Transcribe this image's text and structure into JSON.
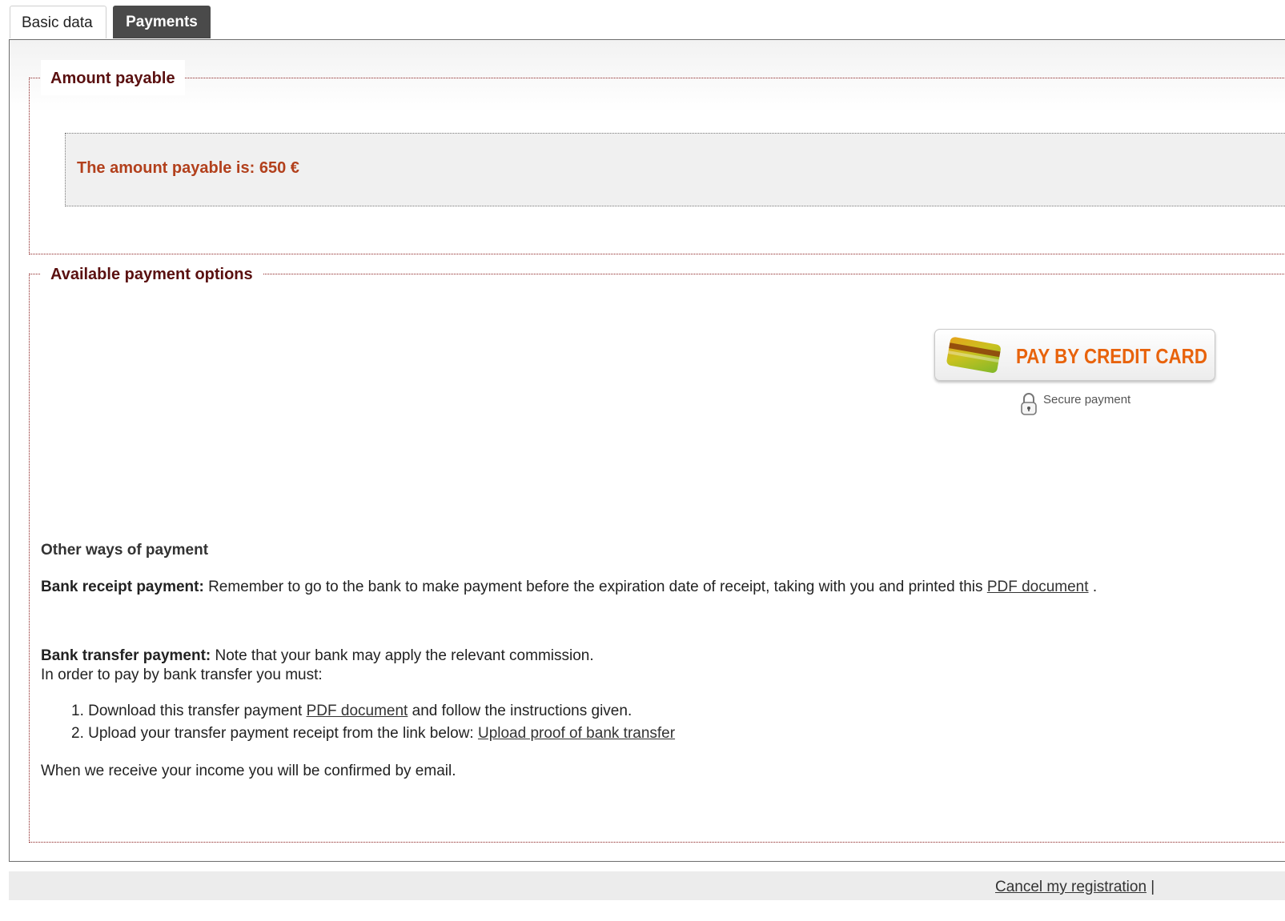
{
  "tabs": [
    {
      "label": "Basic data",
      "active": false
    },
    {
      "label": "Payments",
      "active": true
    }
  ],
  "amount_section": {
    "legend": "Amount payable",
    "text": "The amount payable is: 650 €"
  },
  "options_section": {
    "legend": "Available payment options",
    "credit_card_button": "PAY BY CREDIT CARD",
    "secure_label": "Secure payment",
    "other_title": "Other ways of payment",
    "bank_receipt": {
      "label": "Bank receipt payment:",
      "text": " Remember to go to the bank to make payment before the expiration date of receipt, taking with you and printed this ",
      "link": "PDF document",
      "tail": " ."
    },
    "bank_transfer": {
      "label": "Bank transfer payment:",
      "text": " Note that your bank may apply the relevant commission.",
      "line2": "In order to pay by bank transfer you must:",
      "step1_num": "1.",
      "step1_text": " Download this transfer payment ",
      "step1_link": "PDF document",
      "step1_tail": " and follow the instructions given.",
      "step2_num": "2.",
      "step2_text": " Upload your transfer payment receipt from the link below: ",
      "step2_link": "Upload proof of bank transfer"
    },
    "confirmation": "When we receive your income you will be confirmed by email."
  },
  "footer": {
    "cancel_link": "Cancel my registration",
    "separator": " |"
  },
  "colors": {
    "legend": "#5a1010",
    "amount_text": "#b2401c",
    "button_text": "#e8630c",
    "active_tab": "#4a4a4a"
  }
}
